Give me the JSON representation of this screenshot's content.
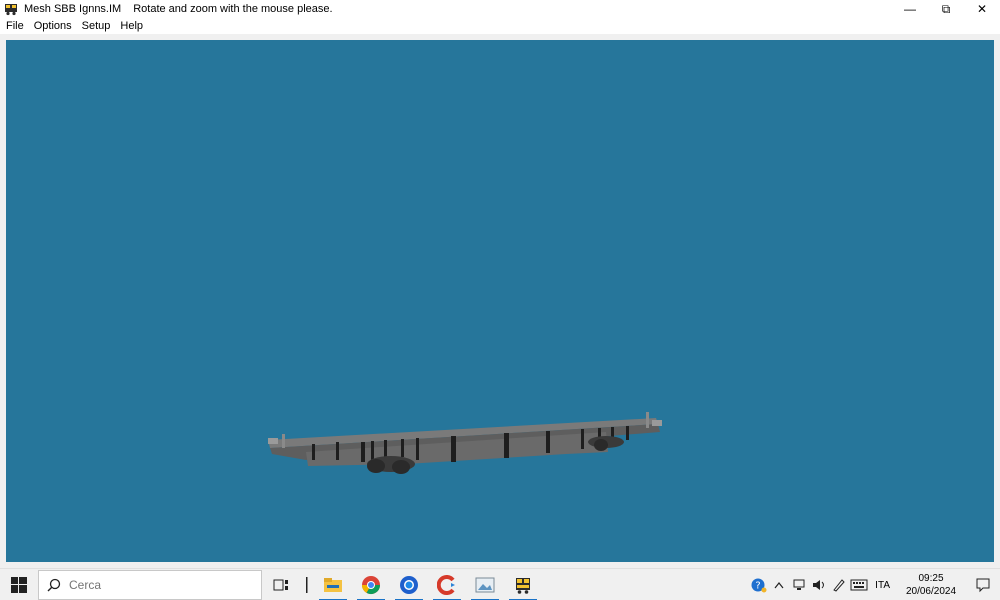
{
  "window": {
    "title": "Mesh SBB Ignns.IM",
    "subtitle": "Rotate and zoom with the mouse please.",
    "icon": "locomotive-icon",
    "controls": {
      "minimize": "—",
      "restore": "⧉",
      "close": "✕"
    }
  },
  "menu": {
    "items": [
      "File",
      "Options",
      "Setup",
      "Help"
    ]
  },
  "viewport": {
    "background": "#26769b",
    "model_color": "#6f6f6f"
  },
  "taskbar": {
    "search_placeholder": "Cerca",
    "apps": [
      {
        "name": "task-view-icon"
      },
      {
        "name": "divider-icon"
      },
      {
        "name": "file-explorer-icon"
      },
      {
        "name": "chrome-icon"
      },
      {
        "name": "firefox-icon"
      },
      {
        "name": "ccleaner-icon"
      },
      {
        "name": "image-viewer-icon"
      },
      {
        "name": "train-app-icon"
      }
    ],
    "tray": {
      "language": "ITA",
      "time": "09:25",
      "date": "20/06/2024"
    }
  }
}
